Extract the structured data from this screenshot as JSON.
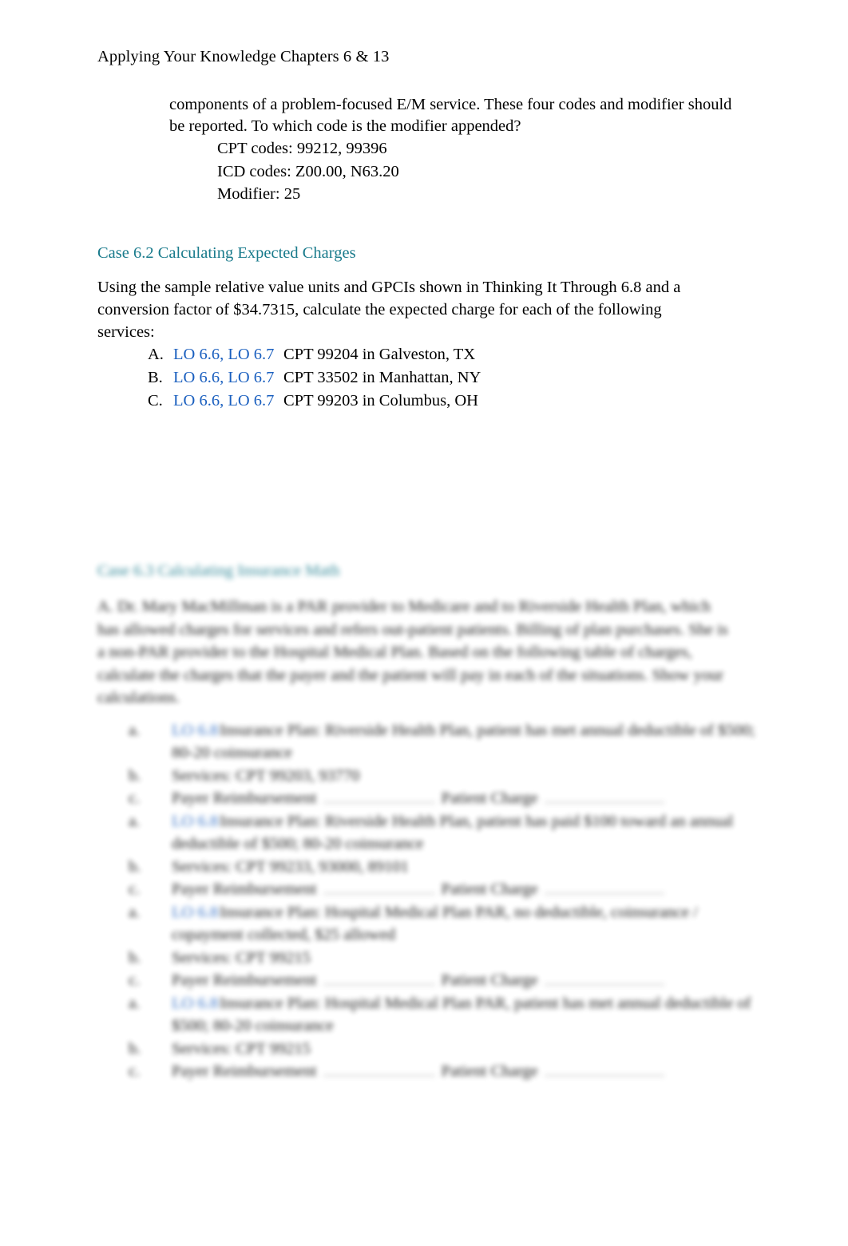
{
  "document": {
    "header": "Applying Your Knowledge Chapters 6 & 13"
  },
  "colors": {
    "heading_teal": "#1a7b8c",
    "lo_blue": "#1a5fbf",
    "body_text": "#000000",
    "page_background": "#ffffff",
    "blank_rule": "#9a9a9a"
  },
  "top_section": {
    "continued_paragraph": "components of a problem-focused E/M service. These four codes and modifier should be reported. To which code is the modifier appended?",
    "answer_lines": [
      "CPT codes: 99212, 99396",
      "ICD codes: Z00.00, N63.20",
      "Modifier: 25"
    ]
  },
  "case_6_2": {
    "heading": "Case 6.2 Calculating Expected Charges",
    "instructions": "Using the sample relative value units and GPCIs shown in Thinking It Through 6.8 and a conversion factor of $34.7315, calculate the expected charge for each of the following services:",
    "items": [
      {
        "marker": "A.",
        "lo": "LO 6.6, LO 6.7",
        "text": "CPT 99204 in Galveston, TX"
      },
      {
        "marker": "B.",
        "lo": "LO 6.6, LO 6.7",
        "text": "CPT 33502 in Manhattan, NY"
      },
      {
        "marker": "C.",
        "lo": "LO 6.6, LO 6.7",
        "text": "CPT 99203 in Columbus, OH"
      }
    ]
  },
  "case_6_3": {
    "heading": "Case 6.3 Calculating Insurance Math",
    "instructions": "A. Dr. Mary MacMillman is a PAR provider to Medicare and to Riverside Health Plan, which has allowed charges for services and refers out-patient patients. Billing of plan purchases. She is a non-PAR provider to the Hospital Medical Plan. Based on the following table of charges, calculate the charges that the payer and the patient will pay in each of the situations. Show your calculations.",
    "groups": [
      {
        "marker": "a.",
        "lo": "LO 6.8",
        "text": "Insurance Plan: Riverside Health Plan, patient has met annual deductible of $500; 80-20 coinsurance",
        "service_marker": "b.",
        "service": "Services: CPT 99203, 93770",
        "result_marker": "c.",
        "result_label_1": "Payer Reimbursement",
        "result_label_2": "Patient Charge"
      },
      {
        "marker": "a.",
        "lo": "LO 6.8",
        "text": "Insurance Plan: Riverside Health Plan, patient has paid $100 toward an annual deductible of $500; 80-20 coinsurance",
        "service_marker": "b.",
        "service": "Services: CPT 99233, 93000, 89101",
        "result_marker": "c.",
        "result_label_1": "Payer Reimbursement",
        "result_label_2": "Patient Charge"
      },
      {
        "marker": "a.",
        "lo": "LO 6.8",
        "text": "Insurance Plan: Hospital Medical Plan PAR, no deductible, coinsurance / copayment collected, $25 allowed",
        "service_marker": "b.",
        "service": "Services: CPT 99215",
        "result_marker": "c.",
        "result_label_1": "Payer Reimbursement",
        "result_label_2": "Patient Charge"
      },
      {
        "marker": "a.",
        "lo": "LO 6.8",
        "text": "Insurance Plan: Hospital Medical Plan PAR, patient has met annual deductible of $500; 80-20 coinsurance",
        "service_marker": "b.",
        "service": "Services: CPT 99215",
        "result_marker": "c.",
        "result_label_1": "Payer Reimbursement",
        "result_label_2": "Patient Charge"
      }
    ]
  }
}
